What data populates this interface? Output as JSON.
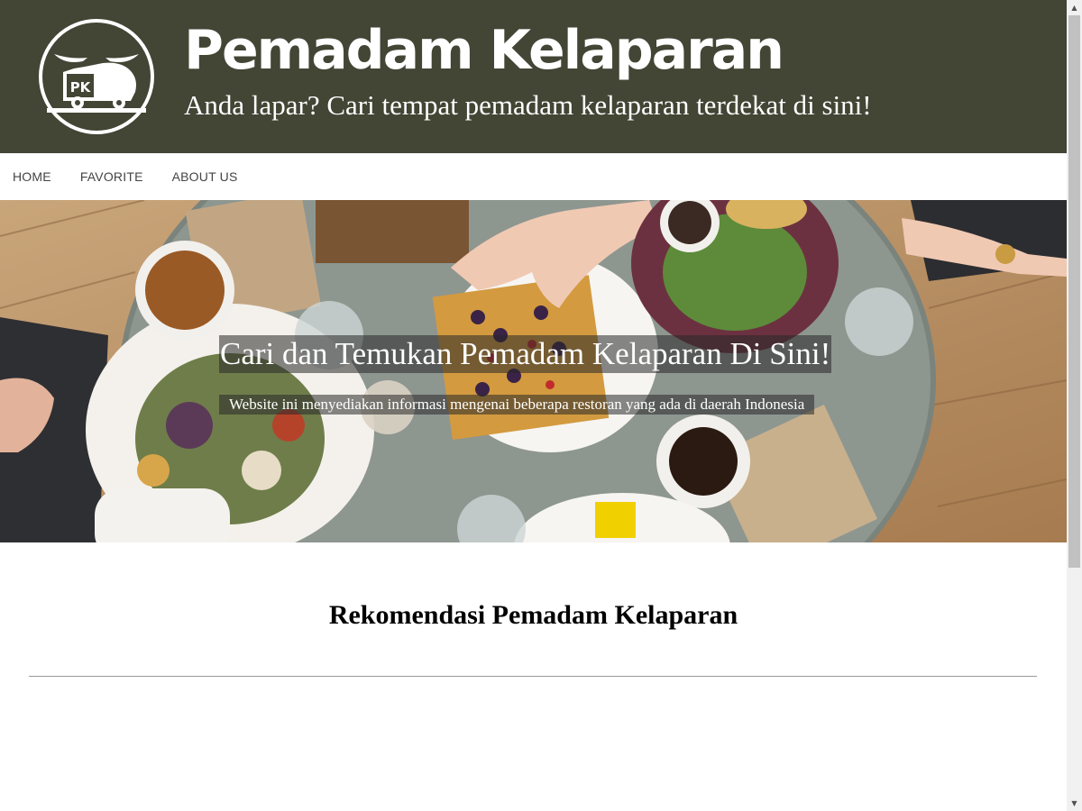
{
  "header": {
    "logo_text": "PK",
    "title": "Pemadam Kelaparan",
    "tagline": "Anda lapar? Cari tempat pemadam kelaparan terdekat di sini!",
    "background_color": "#434535"
  },
  "nav": {
    "items": [
      {
        "label": "HOME"
      },
      {
        "label": "FAVORITE"
      },
      {
        "label": "ABOUT US"
      }
    ]
  },
  "hero": {
    "title": "Cari dan Temukan Pemadam Kelaparan Di Sini!",
    "description": "Website ini menyediakan informasi mengenai beberapa restoran yang ada di daerah Indonesia"
  },
  "recommendation": {
    "title": "Rekomendasi Pemadam Kelaparan"
  },
  "icons": {
    "logo": "food-truck-logo-icon",
    "scroll_up": "scroll-up-arrow-icon",
    "scroll_down": "scroll-down-arrow-icon"
  }
}
